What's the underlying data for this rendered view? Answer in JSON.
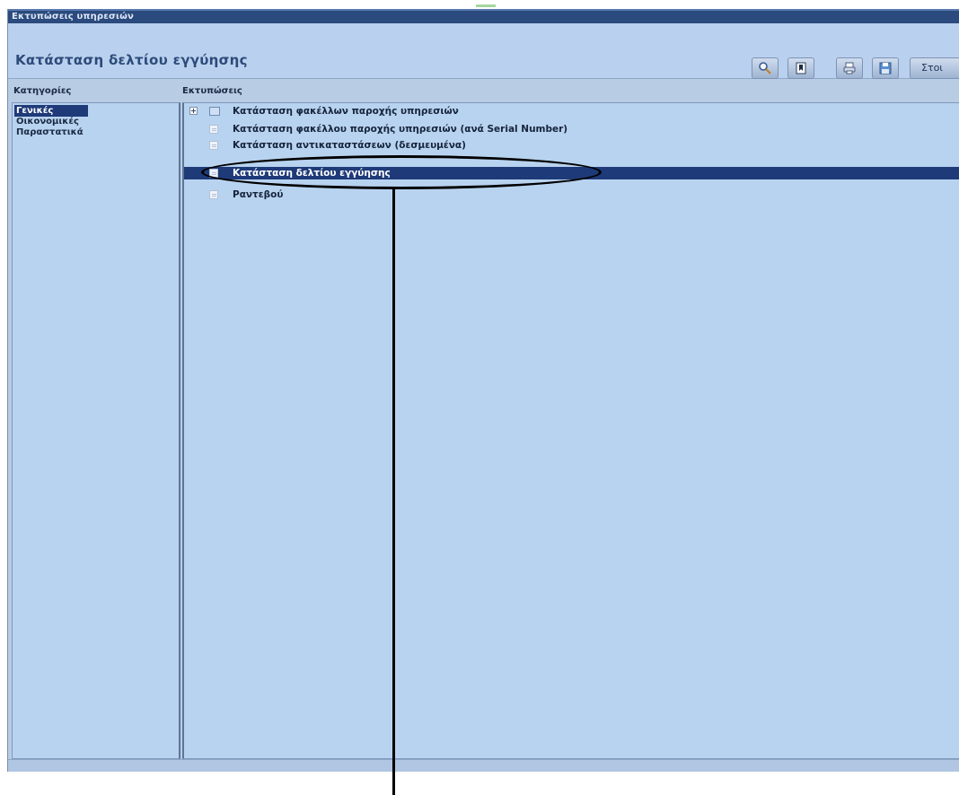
{
  "window": {
    "title": "Εκτυπώσεις υπηρεσιών"
  },
  "header": {
    "title": "Κατάσταση δελτίου εγγύησης",
    "toolbar": [
      {
        "name": "search-report-button",
        "icon": "magnifier-icon"
      },
      {
        "name": "bookmark-button",
        "icon": "bookmark-icon"
      },
      {
        "name": "print-button",
        "icon": "printer-icon"
      },
      {
        "name": "save-button",
        "icon": "floppy-disk-icon"
      }
    ],
    "wide_button_label": "Στοι"
  },
  "categories": {
    "heading": "Κατηγορίες",
    "items": [
      "Γενικές",
      "Οικονομικές",
      "Παραστατικά"
    ],
    "selected_index": 0
  },
  "reports": {
    "heading": "Εκτυπώσεις",
    "items": [
      {
        "label": "Κατάσταση φακέλλων παροχής υπηρεσιών",
        "expandable": true
      },
      {
        "label": "Κατάσταση φακέλλου παροχής υπηρεσιών (ανά Serial Number)",
        "expandable": false
      },
      {
        "label": "Κατάσταση αντικαταστάσεων (δεσμευμένα)",
        "expandable": false
      },
      {
        "label": "Κατάσταση δελτίου εγγύησης",
        "expandable": false
      },
      {
        "label": "Ραντεβού",
        "expandable": false
      }
    ],
    "selected_index": 3
  },
  "colors": {
    "selection": "#1e3a78",
    "panel_bg": "#b8d3ef",
    "title_text": "#2c4a7a",
    "callout": "#000000"
  }
}
